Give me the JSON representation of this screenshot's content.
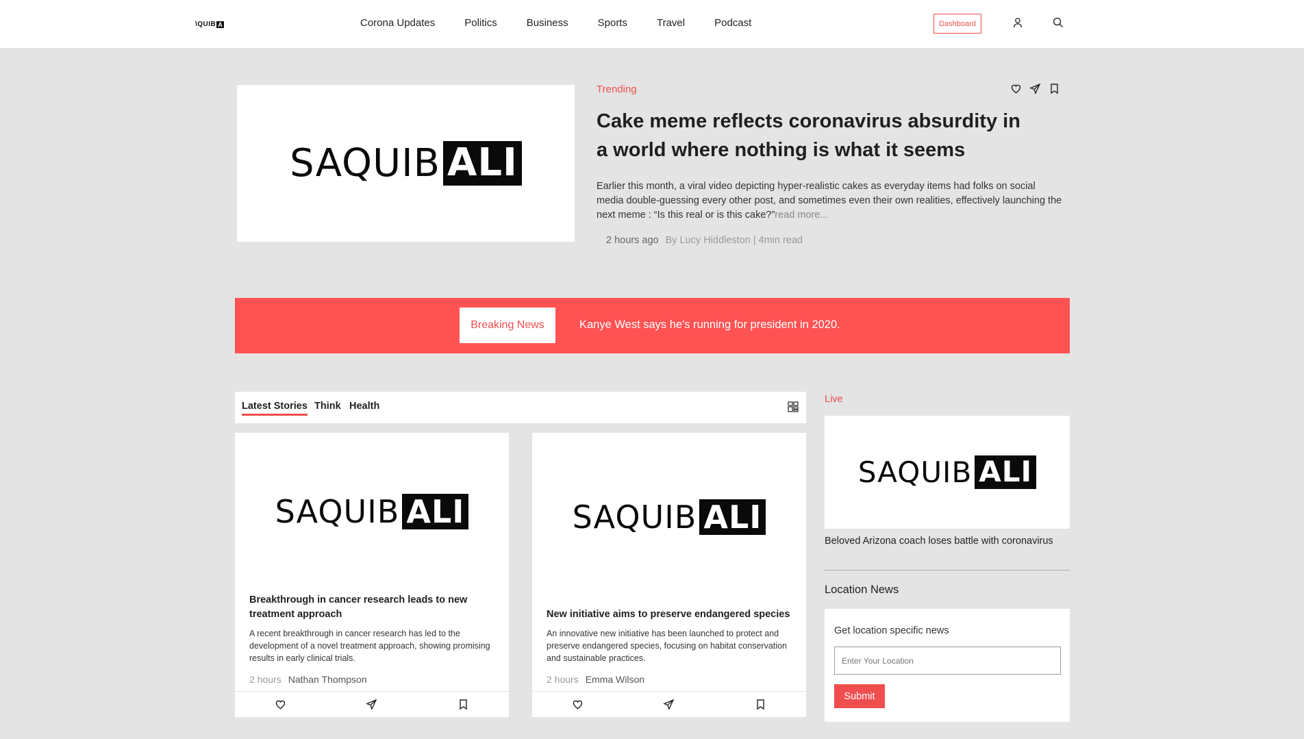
{
  "header": {
    "logo_text": "\\QUIB",
    "logo_box": "A",
    "nav": [
      "Corona Updates",
      "Politics",
      "Business",
      "Sports",
      "Travel",
      "Podcast"
    ],
    "dashboard_label": "Dashboard"
  },
  "hero": {
    "brand_word": "SAQUIB",
    "brand_box": "ALI",
    "tag": "Trending",
    "title": "Cake meme reflects coronavirus absurdity in a world where nothing is what it seems",
    "excerpt": "Earlier this month, a viral video depicting hyper-realistic cakes as everyday items had folks on social media double-guessing every other post, and sometimes even their own realities, effectively launching the next meme : “Is this real or is this cake?”",
    "read_more": "read more...",
    "time": "2 hours ago",
    "byline": "By Lucy Hiddleston | 4min read"
  },
  "breaking": {
    "label": "Breaking News",
    "text": "Kanye West says he's running for president in 2020."
  },
  "tabs": [
    "Latest Stories",
    "Think",
    "Health"
  ],
  "cards": [
    {
      "brand_word": "SAQUIB",
      "brand_box": "ALI",
      "title": "Breakthrough in cancer research leads to new treatment approach",
      "text": "A recent breakthrough in cancer research has led to the development of a novel treatment approach, showing promising results in early clinical trials.",
      "time": "2 hours",
      "author": "Nathan Thompson"
    },
    {
      "brand_word": "SAQUIB",
      "brand_box": "ALI",
      "title": "New initiative aims to preserve endangered species",
      "text": "An innovative new initiative has been launched to protect and preserve endangered species, focusing on habitat conservation and sustainable practices.",
      "time": "2 hours",
      "author": "Emma Wilson"
    }
  ],
  "live": {
    "label": "Live",
    "brand_word": "SAQUIB",
    "brand_box": "ALI",
    "caption": "Beloved Arizona coach loses battle with coronavirus"
  },
  "location": {
    "title": "Location News",
    "label": "Get location specific news",
    "placeholder": "Enter Your Location",
    "submit": "Submit"
  },
  "colors": {
    "accent": "#f04e4e",
    "breaking_bg": "#ff5252",
    "page_bg": "#e4e4e4"
  }
}
